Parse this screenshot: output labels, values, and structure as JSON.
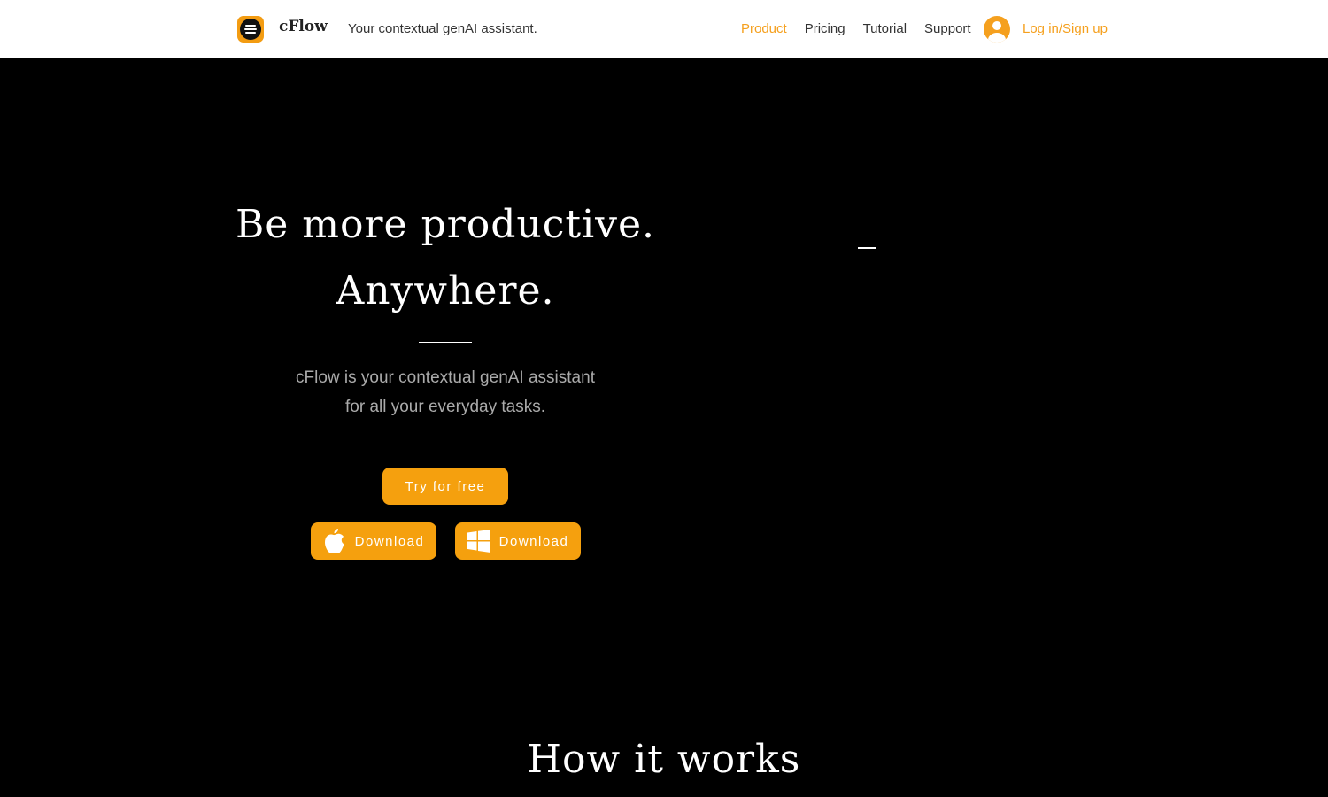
{
  "header": {
    "brand": "cFlow",
    "tagline": "Your contextual genAI assistant.",
    "nav": [
      {
        "label": "Product",
        "active": true
      },
      {
        "label": "Pricing",
        "active": false
      },
      {
        "label": "Tutorial",
        "active": false
      },
      {
        "label": "Support",
        "active": false
      }
    ],
    "login_label": "Log in/Sign up",
    "accent_color": "#f5a01e"
  },
  "hero": {
    "title_line1": "Be more productive.",
    "title_line2": "Anywhere.",
    "subtitle_line1": "cFlow is your contextual genAI assistant",
    "subtitle_line2": "for all your everyday tasks.",
    "try_label": "Try for free",
    "mac_download_label": "Download",
    "windows_download_label": "Download"
  },
  "section": {
    "how_title": "How it works"
  }
}
